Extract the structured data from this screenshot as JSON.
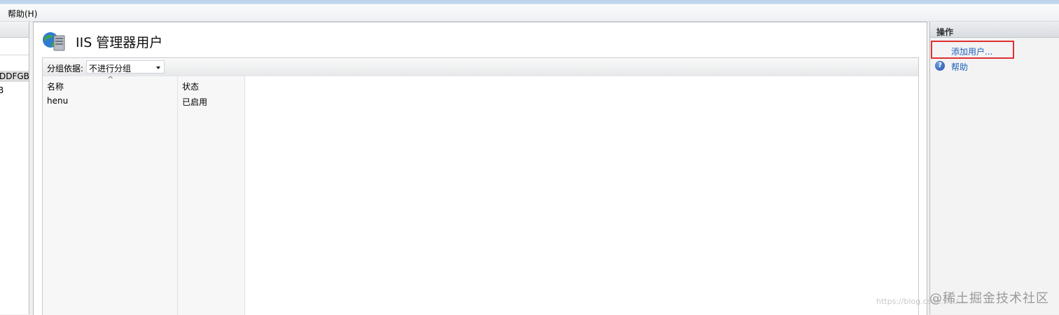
{
  "menubar": {
    "help_label": "帮助(H)"
  },
  "connections": {
    "node_1": "DDFGB",
    "node_2": "B"
  },
  "main": {
    "title": "IIS 管理器用户",
    "group_by_label": "分组依据:",
    "group_by_value": "不进行分组",
    "sort_indicator": "^",
    "columns": [
      "名称",
      "状态"
    ],
    "rows": [
      {
        "name": "henu",
        "status": "已启用"
      }
    ]
  },
  "actions": {
    "title": "操作",
    "add_user": "添加用户...",
    "help": "帮助",
    "help_icon": "?"
  },
  "colors": {
    "highlight": "#e03030",
    "link": "#1f5fbf"
  },
  "watermark": {
    "text": "@稀土掘金技术社区",
    "url": "https://blog.csdn.net/..."
  }
}
